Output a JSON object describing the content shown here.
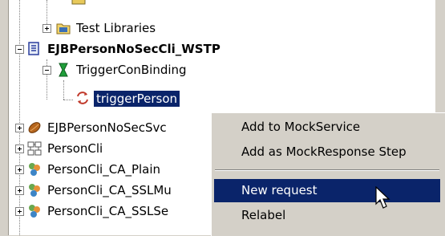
{
  "tree": {
    "items": [
      {
        "label": "Test Libraries",
        "icon": "folder-icon"
      },
      {
        "label": "EJBPersonNoSecCli_WSTP",
        "icon": "interface-icon"
      },
      {
        "label": "TriggerConBinding",
        "icon": "binding-icon"
      },
      {
        "label": "triggerPerson",
        "icon": "operation-icon"
      },
      {
        "label": "EJBPersonNoSecSvc",
        "icon": "ejb-bean-icon"
      },
      {
        "label": "PersonCli",
        "icon": "component-icon"
      },
      {
        "label": "PersonCli_CA_Plain",
        "icon": "project-icon"
      },
      {
        "label": "PersonCli_CA_SSLMu",
        "icon": "project-icon"
      },
      {
        "label": "PersonCli_CA_SSLSe",
        "icon": "project-icon"
      }
    ]
  },
  "context_menu": {
    "items": [
      {
        "label": "Add to MockService"
      },
      {
        "label": "Add as MockResponse Step"
      },
      {
        "label": "New request",
        "highlighted": true
      },
      {
        "label": "Relabel"
      }
    ]
  },
  "colors": {
    "selection": "#0a246a",
    "menu_bg": "#d4d0c8"
  }
}
